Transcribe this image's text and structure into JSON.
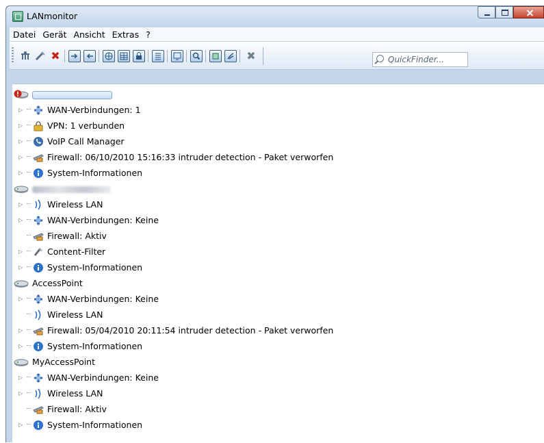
{
  "window": {
    "title": "LANmonitor",
    "controls": [
      "minimize",
      "maximize",
      "close"
    ]
  },
  "menu": [
    "Datei",
    "Gerät",
    "Ansicht",
    "Extras",
    "?"
  ],
  "toolbar": {
    "icons": [
      "connect-device-icon",
      "settings-wand-icon",
      "remove-device-icon",
      "import-icon",
      "export-icon",
      "network-grid-icon",
      "table-icon",
      "lock-icon",
      "list-icon",
      "monitor-search-icon",
      "magnify-icon",
      "lanconfig-icon",
      "wlan-icon",
      "close-tool-icon"
    ],
    "quickfinder_placeholder": "QuickFinder..."
  },
  "tree": {
    "devices": [
      {
        "name": "",
        "name_obscured": true,
        "icon": "alert-device-icon",
        "children": [
          {
            "icon": "wan-icon",
            "label": "WAN-Verbindungen: 1",
            "expandable": true
          },
          {
            "icon": "vpn-lock-icon",
            "label": "VPN: 1 verbunden",
            "expandable": true
          },
          {
            "icon": "voip-icon",
            "label": "VoIP Call Manager",
            "expandable": true
          },
          {
            "icon": "firewall-icon",
            "label": "Firewall: 06/10/2010 15:16:33 intruder detection - Paket verworfen",
            "expandable": true
          },
          {
            "icon": "info-icon",
            "label": "System-Informationen",
            "expandable": true
          }
        ]
      },
      {
        "name": "",
        "name_obscured": true,
        "icon": "router-icon",
        "children": [
          {
            "icon": "wireless-icon",
            "label": "Wireless LAN",
            "expandable": true
          },
          {
            "icon": "wan-icon",
            "label": "WAN-Verbindungen: Keine",
            "expandable": true
          },
          {
            "icon": "firewall-icon",
            "label": "Firewall: Aktiv",
            "expandable": false
          },
          {
            "icon": "content-filter-icon",
            "label": "Content-Filter",
            "expandable": true
          },
          {
            "icon": "info-icon",
            "label": "System-Informationen",
            "expandable": true
          }
        ]
      },
      {
        "name": "AccessPoint",
        "name_obscured": false,
        "icon": "router-icon",
        "children": [
          {
            "icon": "wan-icon",
            "label": "WAN-Verbindungen: Keine",
            "expandable": true
          },
          {
            "icon": "wireless-icon",
            "label": "Wireless LAN",
            "expandable": false
          },
          {
            "icon": "firewall-icon",
            "label": "Firewall: 05/04/2010 20:11:54 intruder detection - Paket verworfen",
            "expandable": true
          },
          {
            "icon": "info-icon",
            "label": "System-Informationen",
            "expandable": true
          }
        ]
      },
      {
        "name": "MyAccessPoint",
        "name_obscured": false,
        "icon": "router-icon",
        "children": [
          {
            "icon": "wan-icon",
            "label": "WAN-Verbindungen: Keine",
            "expandable": true
          },
          {
            "icon": "wireless-icon",
            "label": "Wireless LAN",
            "expandable": true
          },
          {
            "icon": "firewall-icon",
            "label": "Firewall: Aktiv",
            "expandable": false
          },
          {
            "icon": "info-icon",
            "label": "System-Informationen",
            "expandable": true
          }
        ]
      }
    ]
  }
}
